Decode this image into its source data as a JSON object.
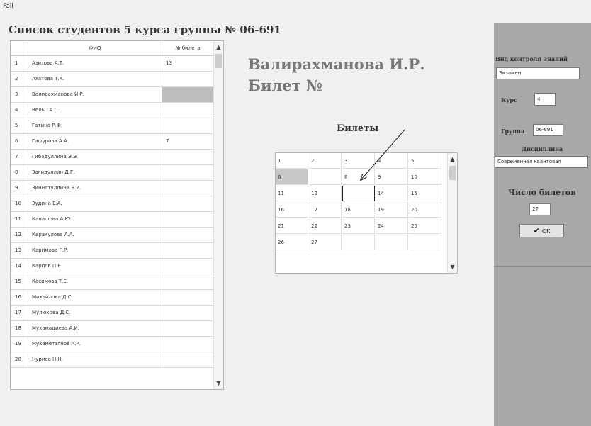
{
  "menu": {
    "file_label": "Fail"
  },
  "title": "Список студентов 5 курса группы № 06-691",
  "students_table": {
    "headers": {
      "name": "ФИО",
      "ticket": "№ билета"
    },
    "rows": [
      {
        "idx": "1",
        "name": "Азизова А.Т.",
        "ticket": "13"
      },
      {
        "idx": "2",
        "name": "Ахатова Т.К.",
        "ticket": ""
      },
      {
        "idx": "3",
        "name": "Валирахманова И.Р.",
        "ticket": ""
      },
      {
        "idx": "4",
        "name": "Вельц А.С.",
        "ticket": ""
      },
      {
        "idx": "5",
        "name": "Гатина Р.Ф.",
        "ticket": ""
      },
      {
        "idx": "6",
        "name": "Гафурова А.А.",
        "ticket": "7"
      },
      {
        "idx": "7",
        "name": "Гибадуллина Э.Э.",
        "ticket": ""
      },
      {
        "idx": "8",
        "name": "Загидуллин Д.Г.",
        "ticket": ""
      },
      {
        "idx": "9",
        "name": "Зиннатуллина Э.И.",
        "ticket": ""
      },
      {
        "idx": "10",
        "name": "Зудина Е.А.",
        "ticket": ""
      },
      {
        "idx": "11",
        "name": "Канашова А.Ю.",
        "ticket": ""
      },
      {
        "idx": "12",
        "name": "Каракулова А.А.",
        "ticket": ""
      },
      {
        "idx": "13",
        "name": "Каримова Г.Р.",
        "ticket": ""
      },
      {
        "idx": "14",
        "name": "Карпов П.Е.",
        "ticket": ""
      },
      {
        "idx": "15",
        "name": "Касимова Т.Е.",
        "ticket": ""
      },
      {
        "idx": "16",
        "name": "Михайлова Д.С.",
        "ticket": ""
      },
      {
        "idx": "17",
        "name": "Мулюкова Д.С.",
        "ticket": ""
      },
      {
        "idx": "18",
        "name": "Мухамадиева А.И.",
        "ticket": ""
      },
      {
        "idx": "19",
        "name": "Мухаметзянов А.Р.",
        "ticket": ""
      },
      {
        "idx": "20",
        "name": "Нуриев Н.Н.",
        "ticket": ""
      }
    ],
    "selected_row": "3",
    "scroll_up_icon": "chevron-up-icon",
    "scroll_down_icon": "chevron-down-icon"
  },
  "current_student": "Валирахманова И.Р.",
  "ticket_caption": "Билет №",
  "tickets_title": "Билеты",
  "tickets_grid": {
    "rows": [
      [
        "1",
        "2",
        "3",
        "4",
        "5"
      ],
      [
        "6",
        "",
        "8",
        "9",
        "10"
      ],
      [
        "11",
        "12",
        "",
        "14",
        "15"
      ],
      [
        "16",
        "17",
        "18",
        "19",
        "20"
      ],
      [
        "21",
        "22",
        "23",
        "24",
        "25"
      ],
      [
        "26",
        "27",
        "",
        "",
        ""
      ]
    ],
    "highlighted_cell": "6",
    "focused_cell": "row 3, column 3"
  },
  "right_panel": {
    "control_label": "Вид контроля знаний",
    "control_value": "Экзамен",
    "course_label": "Курс",
    "course_value": "4",
    "group_label": "Группа",
    "group_value": "06-691",
    "discipline_label": "Дисциплина",
    "discipline_value": "Современная квантовая",
    "tickets_count_label": "Число билетов",
    "tickets_count_value": "27",
    "ok_label": "OK",
    "ok_icon": "checkmark-icon",
    "panel_color": "#a8a8a8"
  }
}
